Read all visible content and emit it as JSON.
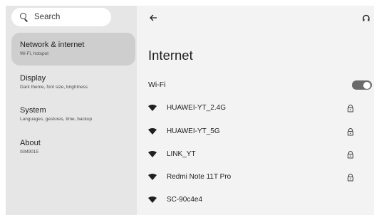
{
  "sidebar": {
    "search_label": "Search",
    "items": [
      {
        "title": "Network & internet",
        "subtitle": "Wi-Fi, hotspot"
      },
      {
        "title": "Display",
        "subtitle": "Dark theme, font size, brightness"
      },
      {
        "title": "System",
        "subtitle": "Languages, gestures, time, backup"
      },
      {
        "title": "About",
        "subtitle": "ISM9015"
      }
    ]
  },
  "main": {
    "title": "Internet",
    "wifi_label": "Wi-Fi",
    "wifi_enabled": true,
    "networks": [
      {
        "name": "HUAWEI-YT_2.4G",
        "secured": true
      },
      {
        "name": "HUAWEI-YT_5G",
        "secured": true
      },
      {
        "name": "LINK_YT",
        "secured": true
      },
      {
        "name": "Redmi Note 11T Pro",
        "secured": true
      },
      {
        "name": "SC-90c4e4",
        "secured": false
      }
    ]
  },
  "icons": {
    "back": "arrow-left-icon",
    "help": "help-icon",
    "search": "search-icon",
    "wifi": "wifi-icon",
    "lock": "lock-icon"
  },
  "colors": {
    "sidebar_bg": "#e6e6e6",
    "active_item_bg": "#cecece",
    "main_bg": "#f3f3f3",
    "toggle_on": "#6a6a6a"
  }
}
